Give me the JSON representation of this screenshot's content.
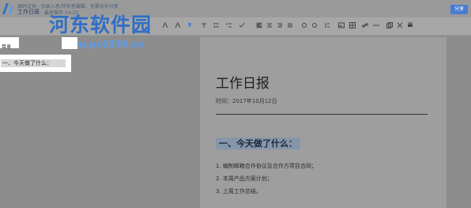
{
  "header": {
    "top_line": "源码文档 · 仅录入者/所有者编辑，无需另外分享",
    "doc_title": "工作日报",
    "saved_status": "最后保存 14:22",
    "share_label": "分享"
  },
  "watermark": {
    "primary": "河东软件园",
    "secondary": "www.pc0359.cn"
  },
  "sidebar": {
    "label": "目录",
    "items": [
      {
        "label": "一、今天做了什么："
      }
    ]
  },
  "document": {
    "title": "工作日报",
    "date_label": "时间：2017年10月12日",
    "section_heading": "一、今天做了什么：",
    "list": [
      "1. 编制邮箱合作协议及合作方项目合同；",
      "2. 本周产品方案计划；",
      "3. 上周工作总结。"
    ]
  },
  "colors": {
    "share_button": "#4a7bd0",
    "watermark_blue": "#2f6ec5",
    "heading_highlight": "#8596aa"
  }
}
